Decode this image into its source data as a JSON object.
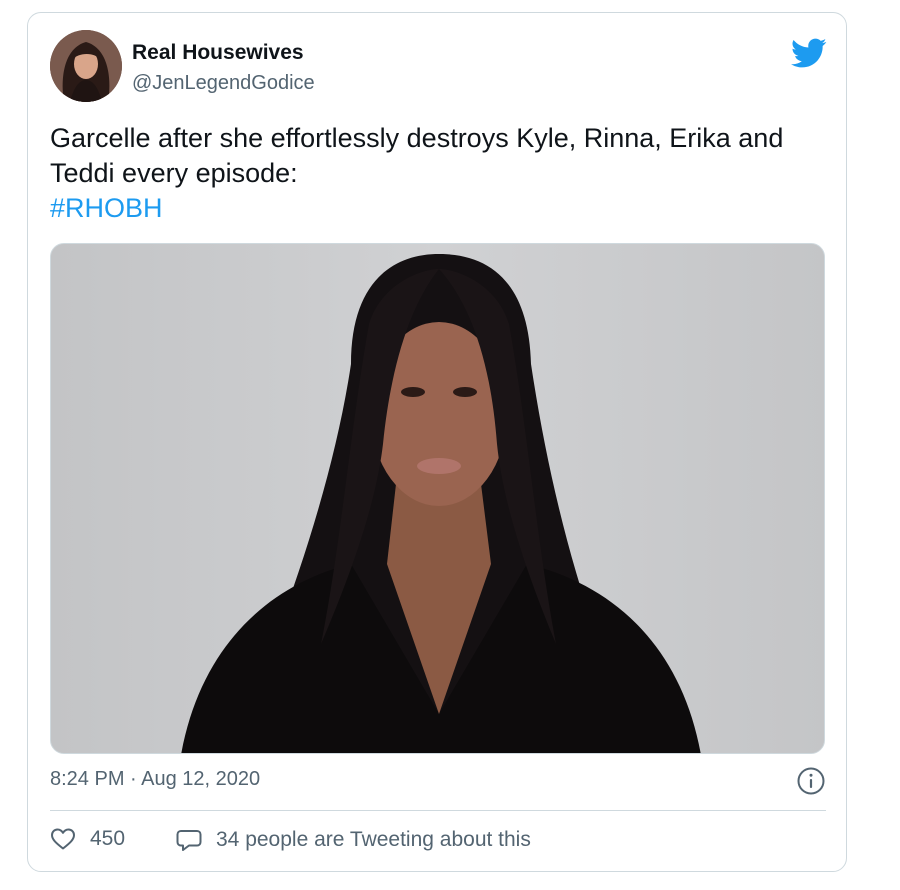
{
  "tweet": {
    "author_name": "Real Housewives",
    "author_handle": "@JenLegendGodice",
    "text": "Garcelle after she effortlessly destroys Kyle, Rinna, Erika and Teddi every episode:",
    "hashtag": "#RHOBH",
    "timestamp": "8:24 PM · Aug 12, 2020",
    "like_count": "450",
    "conversation_label": "34 people are Tweeting about this"
  },
  "icons": {
    "brand": "twitter-bird-icon",
    "info": "info-icon",
    "like": "heart-icon",
    "reply": "speech-bubble-icon"
  },
  "colors": {
    "accent": "#1d9bf0",
    "secondary_text": "#536471",
    "border": "#cfd9de"
  }
}
